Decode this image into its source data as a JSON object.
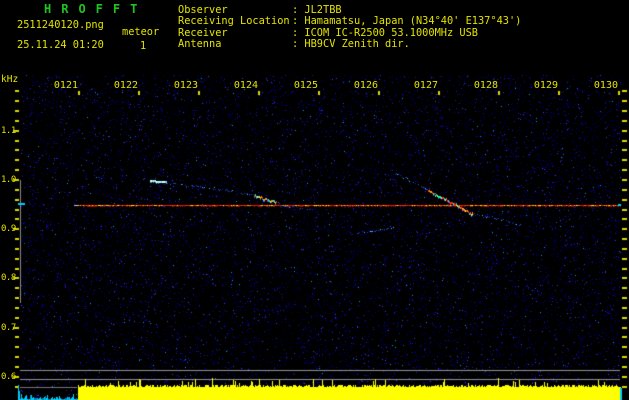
{
  "header": {
    "title": "HROFFT",
    "filename": "2511240120.png",
    "mode": "meteor",
    "count": "1",
    "datetime": "25.11.24 01:20",
    "fields": [
      {
        "label": "Observer",
        "value": "JL2TBB"
      },
      {
        "label": "Receiving Location",
        "value": "Hamamatsu, Japan (N34°40' E137°43')"
      },
      {
        "label": "Receiver",
        "value": "ICOM IC-R2500 53.1000MHz USB"
      },
      {
        "label": "Antenna",
        "value": "HB9CV Zenith dir."
      }
    ]
  },
  "chart_data": {
    "type": "heatmap",
    "subtype": "radio-meteor-doppler-spectrogram",
    "title": "HROFFT 10-minute spectrogram",
    "ylabel": "kHz",
    "x_tick_labels": [
      "0121",
      "0122",
      "0123",
      "0124",
      "0125",
      "0126",
      "0127",
      "0128",
      "0129",
      "0130"
    ],
    "x_minutes_per_div": 1,
    "y_tick_labels": [
      "1.1",
      "1.0",
      "0.9",
      "0.8",
      "0.7",
      "0.6"
    ],
    "y_tick_khz": [
      1.1,
      1.0,
      0.9,
      0.8,
      0.7,
      0.6
    ],
    "ylim_khz": [
      0.58,
      1.18
    ],
    "grid": false,
    "carrier": {
      "khz": 0.947,
      "start_min": 0,
      "end_min": 9.03,
      "color": "#e01800"
    },
    "meteor_echoes": [
      {
        "name": "echo-1",
        "points": [
          [
            1.2,
            0.998
          ],
          [
            1.47,
            0.995
          ],
          [
            2.1,
            0.986
          ],
          [
            2.87,
            0.9715
          ],
          [
            3.28,
            0.9575
          ],
          [
            3.45,
            0.947
          ],
          [
            3.87,
            0.941
          ]
        ],
        "bright": [
          [
            1.2,
            1.48
          ],
          [
            2.92,
            3.3
          ]
        ],
        "head": true
      },
      {
        "name": "echo-2",
        "points": [
          [
            5.23,
            1.018
          ],
          [
            5.78,
            0.984
          ],
          [
            5.83,
            0.98
          ],
          [
            6.4,
            0.944
          ],
          [
            6.57,
            0.932
          ],
          [
            7.12,
            0.919
          ],
          [
            7.4,
            0.909
          ]
        ],
        "bright": [
          [
            5.83,
            6.57
          ]
        ],
        "head": false
      },
      {
        "name": "echo-3-faint",
        "points": [
          [
            4.65,
            0.8925
          ],
          [
            4.95,
            0.898
          ],
          [
            5.25,
            0.9035
          ]
        ],
        "bright": [],
        "head": false
      }
    ],
    "level_bar": {
      "start_min": 0.0,
      "end_min": 9.03,
      "color": "#ffff00"
    },
    "noise": {
      "style": "dark-blue-speckle",
      "density": 0.055
    }
  },
  "colors": {
    "text_yellow": "#e3e300",
    "title_green": "#1fc41f",
    "grid_gray": "#909090",
    "trail_blue": "#2d55e6",
    "level_yellow": "#ffff00",
    "marker_cyan": "#00d0ff"
  }
}
